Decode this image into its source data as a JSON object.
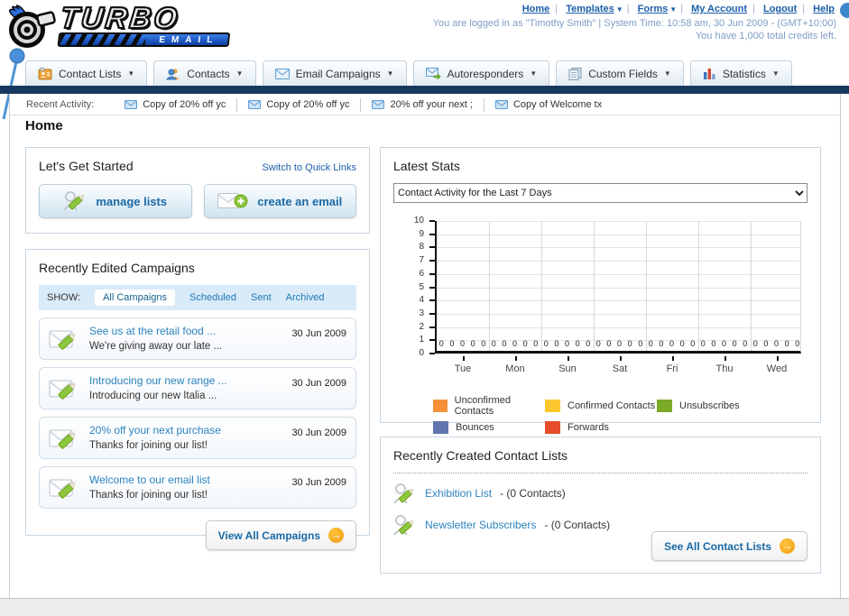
{
  "header": {
    "logo": {
      "title": "TURBO",
      "subtitle": "EMAIL"
    },
    "nav": [
      {
        "label": "Home"
      },
      {
        "label": "Templates"
      },
      {
        "label": "Forms"
      },
      {
        "label": "My Account"
      },
      {
        "label": "Logout"
      },
      {
        "label": "Help"
      }
    ],
    "login_info": "You are logged in as \"Timothy Smith\" | System Time: 10:58 am, 30 Jun 2009 - (GMT+10:00)",
    "credits_info": "You have 1,000 total credits left."
  },
  "main_nav": [
    {
      "label": "Contact Lists"
    },
    {
      "label": "Contacts"
    },
    {
      "label": "Email Campaigns"
    },
    {
      "label": "Autoresponders"
    },
    {
      "label": "Custom Fields"
    },
    {
      "label": "Statistics"
    }
  ],
  "recent_activity": {
    "label": "Recent Activity:",
    "items": [
      "Copy of 20% off yc",
      "Copy of 20% off yc",
      "20% off your next ;",
      "Copy of Welcome tx"
    ]
  },
  "page_title": "Home",
  "get_started": {
    "title": "Let's Get Started",
    "switch_link": "Switch to Quick Links",
    "manage_lists_label": "manage lists",
    "create_email_label": "create an email"
  },
  "campaigns": {
    "title": "Recently Edited Campaigns",
    "show_label": "SHOW:",
    "tabs": [
      "All Campaigns",
      "Scheduled",
      "Sent",
      "Archived"
    ],
    "active_tab": "All Campaigns",
    "items": [
      {
        "title": "See us at the retail food ...",
        "subtitle": "We're giving away our late ...",
        "date": "30 Jun 2009"
      },
      {
        "title": "Introducing our new range ...",
        "subtitle": "Introducing our new Italia ...",
        "date": "30 Jun 2009"
      },
      {
        "title": "20% off your next purchase",
        "subtitle": "Thanks for joining our list!",
        "date": "30 Jun 2009"
      },
      {
        "title": "Welcome to our email list",
        "subtitle": "Thanks for joining our list!",
        "date": "30 Jun 2009"
      }
    ],
    "view_all_label": "View All Campaigns"
  },
  "stats": {
    "title": "Latest Stats",
    "selected_option": "Contact Activity for the Last 7 Days"
  },
  "chart_data": {
    "type": "bar",
    "title": "Contact Activity for the Last 7 Days",
    "categories": [
      "Tue",
      "Mon",
      "Sun",
      "Sat",
      "Fri",
      "Thu",
      "Wed"
    ],
    "series": [
      {
        "name": "Unconfirmed Contacts",
        "color": "#f5913a",
        "values": [
          0,
          0,
          0,
          0,
          0,
          0,
          0
        ]
      },
      {
        "name": "Confirmed Contacts",
        "color": "#fcc630",
        "values": [
          0,
          0,
          0,
          0,
          0,
          0,
          0
        ]
      },
      {
        "name": "Unsubscribes",
        "color": "#7baa27",
        "values": [
          0,
          0,
          0,
          0,
          0,
          0,
          0
        ]
      },
      {
        "name": "Bounces",
        "color": "#6076ad",
        "values": [
          0,
          0,
          0,
          0,
          0,
          0,
          0
        ]
      },
      {
        "name": "Forwards",
        "color": "#e64e2b",
        "values": [
          0,
          0,
          0,
          0,
          0,
          0,
          0
        ]
      }
    ],
    "xlabel": "",
    "ylabel": "",
    "ylim": [
      0,
      10
    ],
    "yticks": [
      0,
      1,
      2,
      3,
      4,
      5,
      6,
      7,
      8,
      9,
      10
    ],
    "grid": true,
    "legend_position": "bottom",
    "value_labels_shown": "0"
  },
  "contact_lists": {
    "title": "Recently Created Contact Lists",
    "items": [
      {
        "name": "Exhibition List",
        "detail": "- (0 Contacts)"
      },
      {
        "name": "Newsletter Subscribers",
        "detail": "- (0 Contacts)"
      }
    ],
    "see_all_label": "See All Contact Lists"
  },
  "colors": {
    "navbar": "#17395f",
    "accent_orange": "#f2a71d",
    "link_blue": "#1e7ab5",
    "show_bar_bg": "#d9eaf8"
  }
}
